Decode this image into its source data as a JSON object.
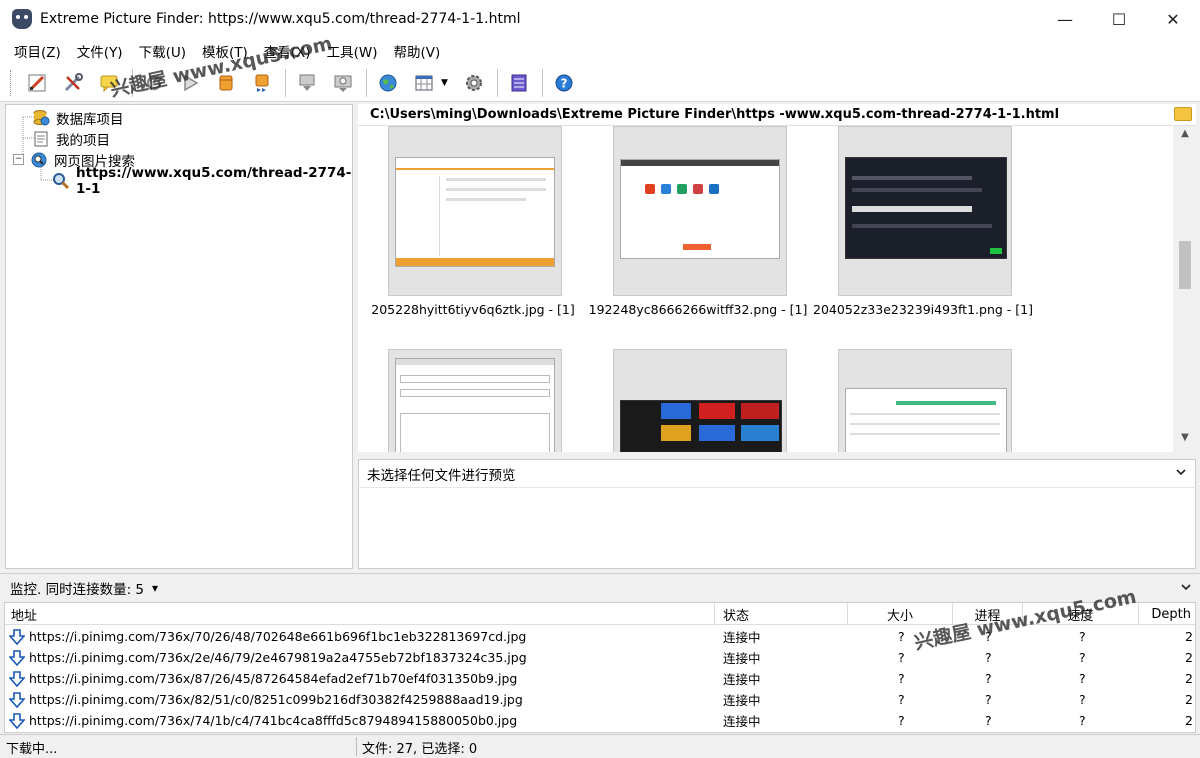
{
  "window": {
    "title": "Extreme Picture Finder: https://www.xqu5.com/thread-2774-1-1.html",
    "controls": {
      "minimize": "—",
      "maximize": "☐",
      "close": "✕"
    }
  },
  "menu": [
    "项目(Z)",
    "文件(Y)",
    "下载(U)",
    "模板(T)",
    "查看(X)",
    "工具(W)",
    "帮助(V)"
  ],
  "watermark": "兴趣屋 www.xqu5.com",
  "tree": {
    "items": [
      {
        "label": "数据库项目",
        "icon": "database-icon"
      },
      {
        "label": "我的项目",
        "icon": "project-icon"
      },
      {
        "label": "网页图片搜索",
        "icon": "web-search-icon",
        "expander": "−"
      },
      {
        "label": "https://www.xqu5.com/thread-2774-1-1",
        "icon": "search-icon"
      }
    ]
  },
  "path": "C:\\Users\\ming\\Downloads\\Extreme Picture Finder\\https -www.xqu5.com-thread-2774-1-1.html",
  "thumbnails": [
    {
      "caption": "205228hyitt6tiyv6q6ztk.jpg - [1]"
    },
    {
      "caption": "192248yc8666266witff32.png - [1]"
    },
    {
      "caption": "204052z33e23239i493ft1.png - [1]"
    },
    {
      "caption": ""
    },
    {
      "caption": ""
    },
    {
      "caption": ""
    }
  ],
  "preview": {
    "label": "未选择任何文件进行预览"
  },
  "monitor": {
    "label": "监控. 同时连接数量: 5",
    "dropdown": "▾"
  },
  "downloads": {
    "headers": {
      "url": "地址",
      "status": "状态",
      "size": "大小",
      "progress": "进程",
      "speed": "速度",
      "depth": "Depth"
    },
    "rows": [
      {
        "url": "https://i.pinimg.com/736x/70/26/48/702648e661b696f1bc1eb322813697cd.jpg",
        "status": "连接中",
        "size": "?",
        "progress": "?",
        "speed": "?",
        "depth": "2"
      },
      {
        "url": "https://i.pinimg.com/736x/2e/46/79/2e4679819a2a4755eb72bf1837324c35.jpg",
        "status": "连接中",
        "size": "?",
        "progress": "?",
        "speed": "?",
        "depth": "2"
      },
      {
        "url": "https://i.pinimg.com/736x/87/26/45/87264584efad2ef71b70ef4f031350b9.jpg",
        "status": "连接中",
        "size": "?",
        "progress": "?",
        "speed": "?",
        "depth": "2"
      },
      {
        "url": "https://i.pinimg.com/736x/82/51/c0/8251c099b216df30382f4259888aad19.jpg",
        "status": "连接中",
        "size": "?",
        "progress": "?",
        "speed": "?",
        "depth": "2"
      },
      {
        "url": "https://i.pinimg.com/736x/74/1b/c4/741bc4ca8fffd5c879489415880050b0.jpg",
        "status": "连接中",
        "size": "?",
        "progress": "?",
        "speed": "?",
        "depth": "2"
      }
    ]
  },
  "status": {
    "left": "下载中...",
    "right": "文件: 27, 已选择: 0"
  }
}
